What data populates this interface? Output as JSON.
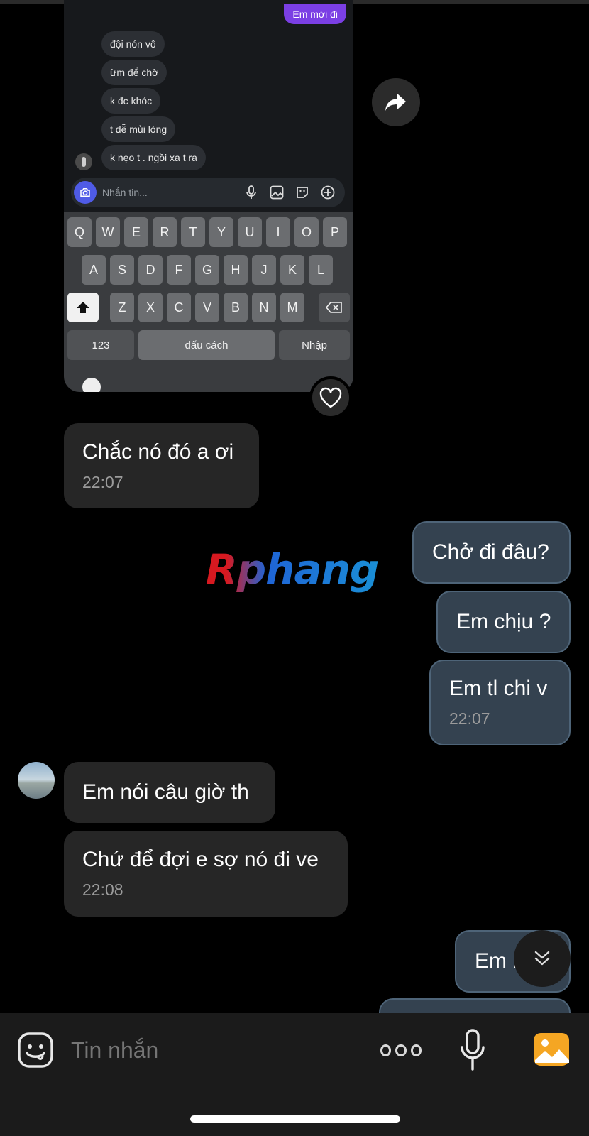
{
  "forwarded_screenshot": {
    "sent_bubble": "Em mới đi",
    "messages": [
      "đội nón vô",
      "ừm để chờ",
      "k đc khóc",
      "t dễ mủi lòng",
      "k nẹo t . ngồi xa t ra"
    ],
    "input_placeholder": "Nhắn tin...",
    "keyboard": {
      "row1": [
        "Q",
        "W",
        "E",
        "R",
        "T",
        "Y",
        "U",
        "I",
        "O",
        "P"
      ],
      "row2": [
        "A",
        "S",
        "D",
        "F",
        "G",
        "H",
        "J",
        "K",
        "L"
      ],
      "row3": [
        "Z",
        "X",
        "C",
        "V",
        "B",
        "N",
        "M"
      ],
      "numbers_key": "123",
      "space_key": "dấu cách",
      "enter_key": "Nhập"
    }
  },
  "watermark": "Rphang",
  "chat": [
    {
      "id": "m1",
      "side": "in",
      "text": "Chắc nó đó a ơi",
      "time": "22:07"
    },
    {
      "id": "m2",
      "side": "out",
      "text": "Chở đi đâu?"
    },
    {
      "id": "m3",
      "side": "out",
      "text": "Em chịu ?"
    },
    {
      "id": "m4",
      "side": "out",
      "text": "Em tl chi v",
      "time": "22:07"
    },
    {
      "id": "m5",
      "side": "in",
      "text": "Em nói câu giờ th"
    },
    {
      "id": "m6",
      "side": "in",
      "text": "Chứ để đợi e sợ nó đi ve",
      "time": "22:08"
    },
    {
      "id": "m7",
      "side": "out",
      "text": "Em l"
    }
  ],
  "composer": {
    "placeholder": "Tin nhắn"
  },
  "colors": {
    "background": "#000000",
    "incoming_bubble": "#262626",
    "outgoing_bubble": "#344250",
    "accent_image_button": "#f5a623"
  },
  "icons": [
    "share-icon",
    "heart-icon",
    "chevron-double-down-icon",
    "emoji-icon",
    "more-dots-icon",
    "microphone-icon",
    "image-icon",
    "camera-icon"
  ]
}
